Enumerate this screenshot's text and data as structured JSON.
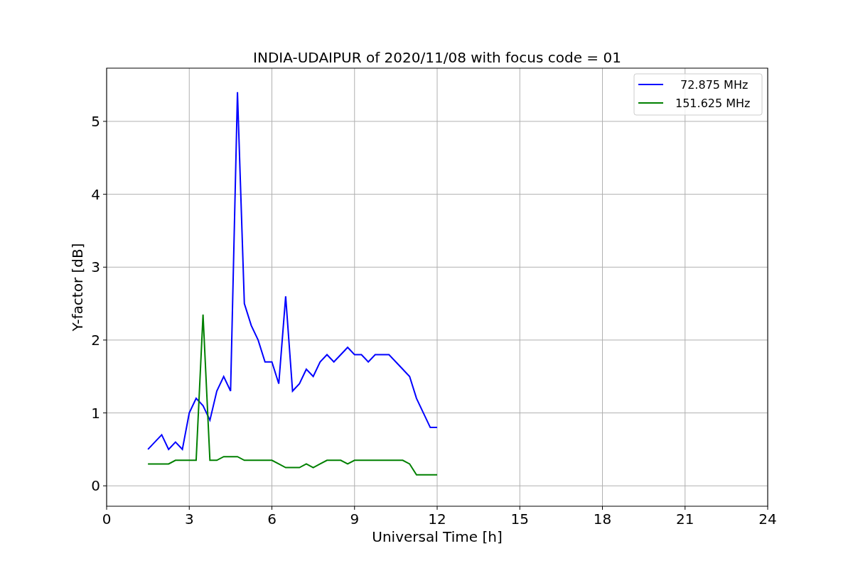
{
  "chart": {
    "chart_data": {
      "type": "line",
      "title": "INDIA-UDAIPUR of 2020/11/08 with focus code = 01",
      "xlabel": "Universal Time [h]",
      "ylabel": "Y-factor [dB]",
      "x": [
        1.5,
        1.75,
        2,
        2.25,
        2.5,
        2.75,
        3,
        3.25,
        3.5,
        3.75,
        4,
        4.25,
        4.5,
        4.75,
        5,
        5.25,
        5.5,
        5.75,
        6,
        6.25,
        6.5,
        6.75,
        7,
        7.25,
        7.5,
        7.75,
        8,
        8.25,
        8.5,
        8.75,
        9,
        9.25,
        9.5,
        9.75,
        10,
        10.25,
        10.5,
        10.75,
        11,
        11.25,
        11.5,
        11.75,
        12
      ],
      "series": [
        {
          "name": "72.875 MHz",
          "color": "#0000ff",
          "values": [
            0.5,
            0.6,
            0.7,
            0.5,
            0.6,
            0.5,
            1.0,
            1.2,
            1.1,
            0.9,
            1.3,
            1.5,
            1.3,
            5.4,
            2.5,
            2.2,
            2.0,
            1.7,
            1.7,
            1.4,
            2.6,
            1.3,
            1.4,
            1.6,
            1.5,
            1.7,
            1.8,
            1.7,
            1.8,
            1.9,
            1.8,
            1.8,
            1.7,
            1.8,
            1.8,
            1.8,
            1.7,
            1.6,
            1.5,
            1.2,
            1.0,
            0.8,
            0.8
          ]
        },
        {
          "name": "151.625 MHz",
          "color": "#008000",
          "values": [
            0.3,
            0.3,
            0.3,
            0.3,
            0.35,
            0.35,
            0.35,
            0.35,
            2.35,
            0.35,
            0.35,
            0.4,
            0.4,
            0.4,
            0.35,
            0.35,
            0.35,
            0.35,
            0.35,
            0.3,
            0.25,
            0.25,
            0.25,
            0.3,
            0.25,
            0.3,
            0.35,
            0.35,
            0.35,
            0.3,
            0.35,
            0.35,
            0.35,
            0.35,
            0.35,
            0.35,
            0.35,
            0.35,
            0.3,
            0.15,
            0.15,
            0.15,
            0.15
          ]
        }
      ],
      "xlim": [
        0,
        24
      ],
      "ylim": [
        -0.28,
        5.73
      ],
      "xticks": [
        0,
        3,
        6,
        9,
        12,
        15,
        18,
        21,
        24
      ],
      "yticks": [
        0,
        1,
        2,
        3,
        4,
        5
      ],
      "grid": true,
      "legend": "upper right"
    }
  }
}
